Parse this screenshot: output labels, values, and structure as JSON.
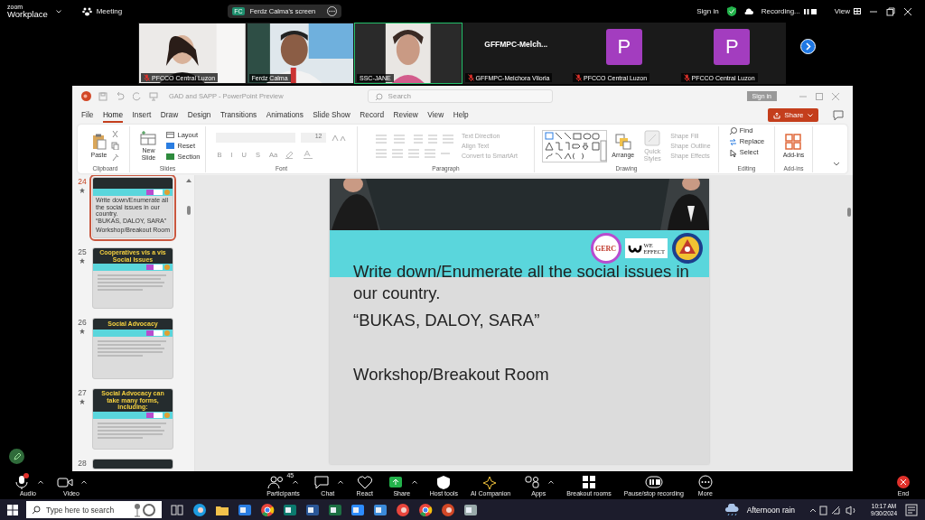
{
  "zoom_bar": {
    "brand_top": "zoom",
    "brand": "Workplace",
    "meeting": "Meeting",
    "sharer_initials": "FC",
    "sharer": "Ferdz Calma's screen",
    "sign_in": "Sign in",
    "recording": "Recording...",
    "view": "View"
  },
  "gallery": [
    {
      "kind": "video",
      "name": "PFCCO Central Luzon",
      "muted": true,
      "selected": false
    },
    {
      "kind": "video",
      "name": "Ferdz Calma",
      "muted": false,
      "selected": false
    },
    {
      "kind": "video",
      "name": "SSC-JANE",
      "muted": false,
      "selected": true
    },
    {
      "kind": "name",
      "display": "GFFMPC-Melch...",
      "name": "GFFMPC-Melchora Viloria",
      "muted": true,
      "selected": false
    },
    {
      "kind": "avatar",
      "initial": "P",
      "name": "PFCCO Central Luzon",
      "muted": true,
      "selected": false
    },
    {
      "kind": "avatar",
      "initial": "P",
      "name": "PFCCO Central Luzon",
      "muted": true,
      "selected": false
    }
  ],
  "powerpoint": {
    "title": "GAD and SAPP - PowerPoint Preview",
    "search_placeholder": "Search",
    "sign_in": "Sign in",
    "share": "Share",
    "tabs": [
      {
        "label": "File",
        "selected": false
      },
      {
        "label": "Home",
        "selected": true
      },
      {
        "label": "Insert",
        "selected": false
      },
      {
        "label": "Draw",
        "selected": false
      },
      {
        "label": "Design",
        "selected": false
      },
      {
        "label": "Transitions",
        "selected": false
      },
      {
        "label": "Animations",
        "selected": false
      },
      {
        "label": "Slide Show",
        "selected": false
      },
      {
        "label": "Record",
        "selected": false
      },
      {
        "label": "Review",
        "selected": false
      },
      {
        "label": "View",
        "selected": false
      },
      {
        "label": "Help",
        "selected": false
      }
    ],
    "ribbon": {
      "paste": "Paste",
      "new_slide": "New Slide",
      "layout": "Layout",
      "reset": "Reset",
      "section": "Section",
      "font_size": "12",
      "font_buttons": [
        "B",
        "I",
        "U",
        "S"
      ],
      "case_button": "Aa",
      "text_direction": "Text Direction",
      "align_text": "Align Text",
      "convert_smartart": "Convert to SmartArt",
      "arrange": "Arrange",
      "quick_styles": "Quick Styles",
      "shape_fill": "Shape Fill",
      "shape_outline": "Shape Outline",
      "shape_effects": "Shape Effects",
      "find": "Find",
      "replace": "Replace",
      "select": "Select",
      "addins": "Add-ins",
      "groups": [
        "Clipboard",
        "Slides",
        "Font",
        "Paragraph",
        "Drawing",
        "Editing",
        "Add-ins"
      ]
    },
    "thumbnails": [
      {
        "number": "24",
        "selected": true,
        "kind": "text",
        "lines": [
          "Write down/Enumerate all the social issues in our country.",
          "“BUKAS, DALOY, SARA”",
          "Workshop/Breakout Room"
        ]
      },
      {
        "number": "25",
        "selected": false,
        "kind": "titled",
        "title": "Cooperatives vis a vis Social Issues"
      },
      {
        "number": "26",
        "selected": false,
        "kind": "titled",
        "title": "Social Advocacy"
      },
      {
        "number": "27",
        "selected": false,
        "kind": "titled",
        "title": "Social Advocacy  can take many forms, including:"
      },
      {
        "number": "28",
        "selected": false,
        "kind": "cut"
      }
    ],
    "slide": {
      "lines": [
        "Write down/Enumerate all the social issues in our country.",
        "“BUKAS, DALOY, SARA”",
        "Workshop/Breakout Room"
      ],
      "logo_gerc": "GERC",
      "logo_we": "WE",
      "logo_effect": "EFFECT"
    }
  },
  "toolbar": [
    {
      "kind": "mic",
      "label": "Audio",
      "caret": true,
      "badge": true
    },
    {
      "kind": "video",
      "label": "Video",
      "caret": true,
      "badge": false
    },
    {
      "kind": "participants",
      "label": "Participants",
      "count": "45",
      "caret": true,
      "badge": false
    },
    {
      "kind": "chat",
      "label": "Chat",
      "caret": true,
      "badge": false
    },
    {
      "kind": "react",
      "label": "React",
      "caret": false,
      "badge": false
    },
    {
      "kind": "share",
      "label": "Share",
      "caret": true,
      "badge": false
    },
    {
      "kind": "host",
      "label": "Host tools",
      "caret": false,
      "badge": false
    },
    {
      "kind": "ai",
      "label": "AI Companion",
      "caret": false,
      "badge": false
    },
    {
      "kind": "apps",
      "label": "Apps",
      "caret": true,
      "badge": false
    },
    {
      "kind": "breakout",
      "label": "Breakout rooms",
      "caret": false,
      "badge": false
    },
    {
      "kind": "record",
      "label": "Pause/stop recording",
      "caret": false,
      "badge": false
    },
    {
      "kind": "more",
      "label": "More",
      "caret": false,
      "badge": false
    },
    {
      "kind": "end",
      "label": "End",
      "caret": false,
      "badge": false
    }
  ],
  "taskbar": {
    "search_placeholder": "Type here to search",
    "apps": [
      {
        "kind": "taskview"
      },
      {
        "kind": "edge"
      },
      {
        "kind": "folder"
      },
      {
        "kind": "mail"
      },
      {
        "kind": "chrome"
      },
      {
        "kind": "publisher"
      },
      {
        "kind": "word"
      },
      {
        "kind": "excel"
      },
      {
        "kind": "zoom"
      },
      {
        "kind": "calendar"
      },
      {
        "kind": "recorder"
      },
      {
        "kind": "chrome"
      },
      {
        "kind": "powerpoint"
      },
      {
        "kind": "tool"
      }
    ],
    "weather": "Afternoon rain",
    "time": "10:17 AM",
    "date": "9/30/2024"
  }
}
